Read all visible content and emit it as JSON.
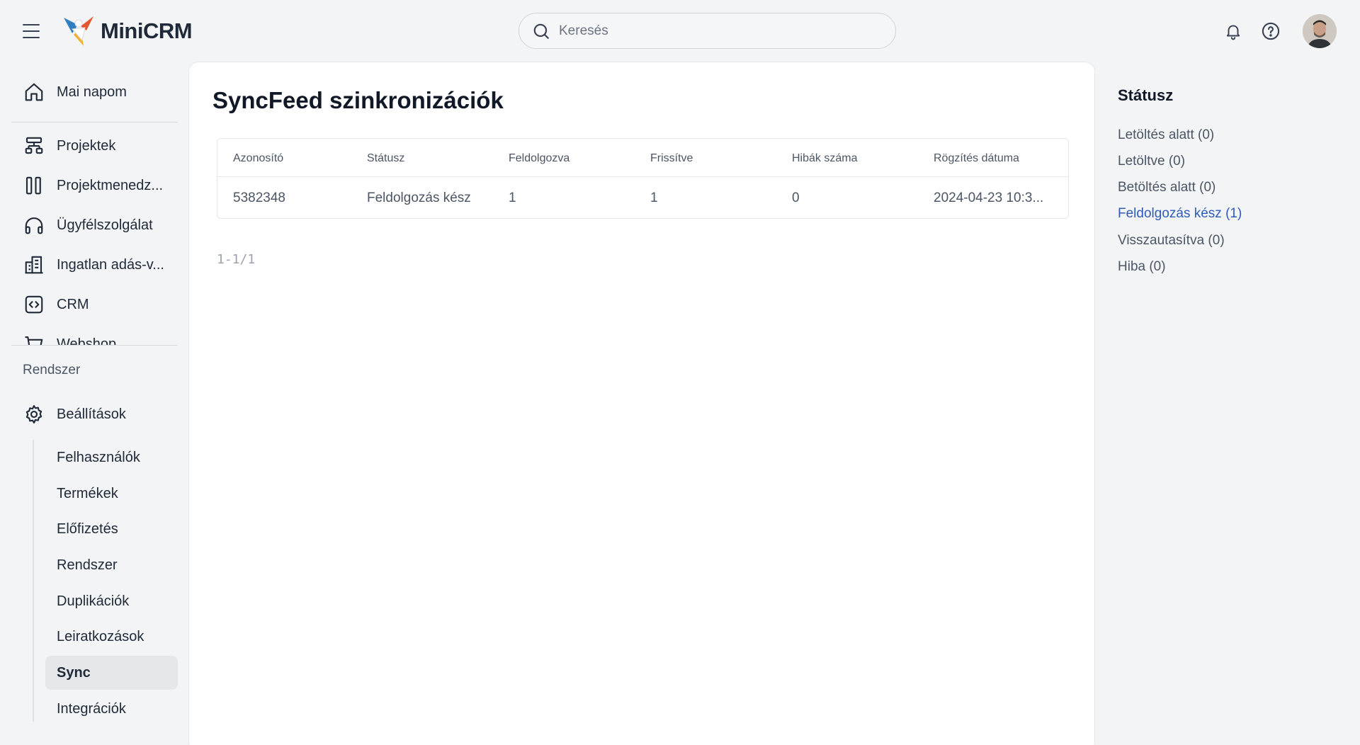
{
  "app": {
    "name": "MiniCRM"
  },
  "search": {
    "placeholder": "Keresés"
  },
  "sidebar": {
    "items": [
      {
        "label": "Mai napom",
        "icon": "home-icon"
      },
      {
        "label": "Projektek",
        "icon": "hierarchy-icon"
      },
      {
        "label": "Projektmenedz...",
        "icon": "kanban-icon"
      },
      {
        "label": "Ügyfélszolgálat",
        "icon": "headphones-icon"
      },
      {
        "label": "Ingatlan adás-v...",
        "icon": "building-icon"
      },
      {
        "label": "CRM",
        "icon": "code-box-icon"
      },
      {
        "label": "Webshop",
        "icon": "cart-icon"
      }
    ],
    "section_label": "Rendszer",
    "settings_label": "Beállítások",
    "sub_items": [
      {
        "label": "Felhasználók"
      },
      {
        "label": "Termékek"
      },
      {
        "label": "Előfizetés"
      },
      {
        "label": "Rendszer"
      },
      {
        "label": "Duplikációk"
      },
      {
        "label": "Leiratkozások"
      },
      {
        "label": "Sync",
        "active": true
      },
      {
        "label": "Integrációk"
      }
    ]
  },
  "main": {
    "title": "SyncFeed szinkronizációk",
    "table": {
      "columns": [
        "Azonosító",
        "Státusz",
        "Feldolgozva",
        "Frissítve",
        "Hibák száma",
        "Rögzítés dátuma"
      ],
      "rows": [
        [
          "5382348",
          "Feldolgozás kész",
          "1",
          "1",
          "0",
          "2024-04-23 10:3..."
        ]
      ]
    },
    "pagination": "1-1/1"
  },
  "status_panel": {
    "title": "Státusz",
    "items": [
      {
        "label": "Letöltés alatt (0)"
      },
      {
        "label": "Letöltve (0)"
      },
      {
        "label": "Betöltés alatt (0)"
      },
      {
        "label": "Feldolgozás kész (1)",
        "active": true
      },
      {
        "label": "Visszautasítva (0)"
      },
      {
        "label": "Hiba (0)"
      }
    ]
  },
  "colors": {
    "accent": "#2f5bb7",
    "background": "#f3f4f6",
    "active_bg": "#e5e7eb"
  }
}
